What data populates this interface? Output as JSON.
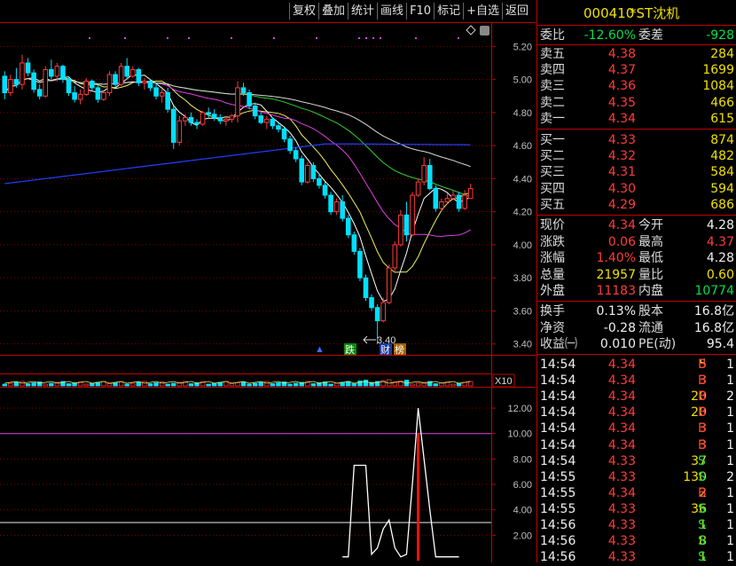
{
  "toolbar": {
    "items": [
      "复权",
      "叠加",
      "统计",
      "画线",
      "F10",
      "标记",
      "+自选",
      "返回"
    ]
  },
  "stock": {
    "code": "000410",
    "name": "*ST沈机"
  },
  "order_stats": {
    "wb_label": "委比",
    "wb_value": "-12.60%",
    "wc_label": "委差",
    "wc_value": "-928"
  },
  "asks": [
    {
      "label": "卖五",
      "price": "4.38",
      "volume": "284"
    },
    {
      "label": "卖四",
      "price": "4.37",
      "volume": "1699"
    },
    {
      "label": "卖三",
      "price": "4.36",
      "volume": "1084"
    },
    {
      "label": "卖二",
      "price": "4.35",
      "volume": "466"
    },
    {
      "label": "卖一",
      "price": "4.34",
      "volume": "615"
    }
  ],
  "bids": [
    {
      "label": "买一",
      "price": "4.33",
      "volume": "874"
    },
    {
      "label": "买二",
      "price": "4.32",
      "volume": "482"
    },
    {
      "label": "买三",
      "price": "4.31",
      "volume": "584"
    },
    {
      "label": "买四",
      "price": "4.30",
      "volume": "594"
    },
    {
      "label": "买五",
      "price": "4.29",
      "volume": "686"
    }
  ],
  "quote": [
    {
      "l1": "现价",
      "v1": "4.34",
      "c1": "red",
      "l2": "今开",
      "v2": "4.28",
      "c2": "white"
    },
    {
      "l1": "涨跌",
      "v1": "0.06",
      "c1": "red",
      "l2": "最高",
      "v2": "4.37",
      "c2": "red"
    },
    {
      "l1": "涨幅",
      "v1": "1.40%",
      "c1": "red",
      "l2": "最低",
      "v2": "4.28",
      "c2": "white"
    },
    {
      "l1": "总量",
      "v1": "21957",
      "c1": "yellow",
      "l2": "量比",
      "v2": "0.60",
      "c2": "yellow"
    },
    {
      "l1": "外盘",
      "v1": "11183",
      "c1": "red",
      "l2": "内盘",
      "v2": "10774",
      "c2": "green"
    }
  ],
  "fundamentals": [
    {
      "l1": "换手",
      "v1": "0.13%",
      "l2": "股本",
      "v2": "16.8亿"
    },
    {
      "l1": "净资",
      "v1": "-0.28",
      "l2": "流通",
      "v2": "16.8亿"
    },
    {
      "l1": "收益㈠",
      "v1": "0.010",
      "l2": "PE(动)",
      "v2": "95.4"
    }
  ],
  "ticks": [
    {
      "time": "14:54",
      "price": "4.34",
      "vol": "5",
      "side": "B",
      "n": "1"
    },
    {
      "time": "14:54",
      "price": "4.34",
      "vol": "3",
      "side": "B",
      "n": "1"
    },
    {
      "time": "14:54",
      "price": "4.34",
      "vol": "20",
      "side": "B",
      "n": "2"
    },
    {
      "time": "14:54",
      "price": "4.34",
      "vol": "20",
      "side": "B",
      "n": "1"
    },
    {
      "time": "14:54",
      "price": "4.34",
      "vol": "3",
      "side": "B",
      "n": "1"
    },
    {
      "time": "14:54",
      "price": "4.34",
      "vol": "3",
      "side": "B",
      "n": "1"
    },
    {
      "time": "14:54",
      "price": "4.33",
      "vol": "37",
      "side": "S",
      "n": "1"
    },
    {
      "time": "14:55",
      "price": "4.33",
      "vol": "130",
      "side": "S",
      "n": "2"
    },
    {
      "time": "14:55",
      "price": "4.34",
      "vol": "2",
      "side": "B",
      "n": "1"
    },
    {
      "time": "14:55",
      "price": "4.33",
      "vol": "36",
      "side": "S",
      "n": "1"
    },
    {
      "time": "14:56",
      "price": "4.33",
      "vol": "1",
      "side": "S",
      "n": "1"
    },
    {
      "time": "14:56",
      "price": "4.33",
      "vol": "8",
      "side": "S",
      "n": "1"
    },
    {
      "time": "14:56",
      "price": "4.33",
      "vol": "1",
      "side": "S",
      "n": "1"
    }
  ],
  "colors": {
    "up": "#ff3b3b",
    "down": "#00e0ff",
    "grid": "#c00000",
    "ma_long": "#2040ff"
  },
  "chart_data": [
    {
      "type": "candlestick",
      "yaxis_ticks": [
        "5.20",
        "5.00",
        "4.80",
        "4.60",
        "4.40",
        "4.20",
        "4.00",
        "3.80",
        "3.60",
        "3.40"
      ],
      "ylim": [
        3.35,
        5.32
      ],
      "low_annotation": "3.40",
      "markers": [
        "跌",
        "财",
        "榜"
      ],
      "candles": [
        [
          5.02,
          5.05,
          4.88,
          4.92
        ],
        [
          4.92,
          5.03,
          4.9,
          5.0
        ],
        [
          5.0,
          5.07,
          4.95,
          4.97
        ],
        [
          4.97,
          5.15,
          4.94,
          5.1
        ],
        [
          5.1,
          5.13,
          5.02,
          5.04
        ],
        [
          5.04,
          5.06,
          4.92,
          4.94
        ],
        [
          4.94,
          4.97,
          4.88,
          4.9
        ],
        [
          4.9,
          5.08,
          4.89,
          5.06
        ],
        [
          5.06,
          5.12,
          5.0,
          5.02
        ],
        [
          5.02,
          5.1,
          4.99,
          5.08
        ],
        [
          5.08,
          5.09,
          4.98,
          5.0
        ],
        [
          5.0,
          5.02,
          4.9,
          4.92
        ],
        [
          4.92,
          4.96,
          4.86,
          4.88
        ],
        [
          4.88,
          4.94,
          4.85,
          4.91
        ],
        [
          4.91,
          5.01,
          4.9,
          4.99
        ],
        [
          4.99,
          5.0,
          4.93,
          4.95
        ],
        [
          4.95,
          4.97,
          4.86,
          4.88
        ],
        [
          4.88,
          4.93,
          4.87,
          4.92
        ],
        [
          4.92,
          5.05,
          4.9,
          5.03
        ],
        [
          5.03,
          5.05,
          4.95,
          4.97
        ],
        [
          4.97,
          5.1,
          4.96,
          5.08
        ],
        [
          5.08,
          5.13,
          5.0,
          5.02
        ],
        [
          5.02,
          5.08,
          5.01,
          5.06
        ],
        [
          5.06,
          5.07,
          4.96,
          4.98
        ],
        [
          4.98,
          5.01,
          4.94,
          4.99
        ],
        [
          4.99,
          5.0,
          4.93,
          4.95
        ],
        [
          4.95,
          4.98,
          4.88,
          4.9
        ],
        [
          4.9,
          4.94,
          4.86,
          4.92
        ],
        [
          4.92,
          4.95,
          4.8,
          4.82
        ],
        [
          4.82,
          4.84,
          4.58,
          4.62
        ],
        [
          4.62,
          4.78,
          4.6,
          4.75
        ],
        [
          4.75,
          4.79,
          4.72,
          4.77
        ],
        [
          4.77,
          4.8,
          4.72,
          4.74
        ],
        [
          4.74,
          4.76,
          4.7,
          4.73
        ],
        [
          4.73,
          4.81,
          4.72,
          4.8
        ],
        [
          4.8,
          4.83,
          4.77,
          4.79
        ],
        [
          4.79,
          4.82,
          4.75,
          4.77
        ],
        [
          4.77,
          4.79,
          4.73,
          4.75
        ],
        [
          4.75,
          4.78,
          4.72,
          4.76
        ],
        [
          4.76,
          4.79,
          4.74,
          4.78
        ],
        [
          4.78,
          4.99,
          4.74,
          4.95
        ],
        [
          4.95,
          4.98,
          4.9,
          4.92
        ],
        [
          4.92,
          4.94,
          4.82,
          4.84
        ],
        [
          4.84,
          4.86,
          4.76,
          4.78
        ],
        [
          4.78,
          4.8,
          4.73,
          4.74
        ],
        [
          4.74,
          4.78,
          4.7,
          4.76
        ],
        [
          4.76,
          4.77,
          4.7,
          4.72
        ],
        [
          4.72,
          4.74,
          4.68,
          4.7
        ],
        [
          4.7,
          4.71,
          4.62,
          4.64
        ],
        [
          4.64,
          4.66,
          4.55,
          4.57
        ],
        [
          4.57,
          4.59,
          4.5,
          4.52
        ],
        [
          4.52,
          4.54,
          4.36,
          4.38
        ],
        [
          4.38,
          4.5,
          4.37,
          4.48
        ],
        [
          4.48,
          4.5,
          4.38,
          4.4
        ],
        [
          4.4,
          4.43,
          4.34,
          4.36
        ],
        [
          4.36,
          4.38,
          4.28,
          4.3
        ],
        [
          4.3,
          4.32,
          4.18,
          4.2
        ],
        [
          4.2,
          4.28,
          4.18,
          4.26
        ],
        [
          4.26,
          4.3,
          4.14,
          4.16
        ],
        [
          4.16,
          4.18,
          4.04,
          4.06
        ],
        [
          4.06,
          4.08,
          3.94,
          3.96
        ],
        [
          3.96,
          3.98,
          3.78,
          3.8
        ],
        [
          3.8,
          3.82,
          3.66,
          3.68
        ],
        [
          3.68,
          3.7,
          3.6,
          3.62
        ],
        [
          3.62,
          3.64,
          3.4,
          3.54
        ],
        [
          3.54,
          3.68,
          3.53,
          3.65
        ],
        [
          3.65,
          3.88,
          3.64,
          3.86
        ],
        [
          3.86,
          4.02,
          3.84,
          4.0
        ],
        [
          4.0,
          4.21,
          3.99,
          4.18
        ],
        [
          4.18,
          4.26,
          4.02,
          4.06
        ],
        [
          4.06,
          4.32,
          4.05,
          4.3
        ],
        [
          4.3,
          4.4,
          4.29,
          4.38
        ],
        [
          4.38,
          4.53,
          4.36,
          4.48
        ],
        [
          4.48,
          4.52,
          4.33,
          4.34
        ],
        [
          4.34,
          4.36,
          4.2,
          4.22
        ],
        [
          4.22,
          4.28,
          4.2,
          4.26
        ],
        [
          4.26,
          4.31,
          4.25,
          4.28
        ],
        [
          4.28,
          4.33,
          4.27,
          4.3
        ],
        [
          4.3,
          4.32,
          4.2,
          4.22
        ],
        [
          4.22,
          4.33,
          4.21,
          4.3
        ],
        [
          4.28,
          4.37,
          4.28,
          4.34
        ]
      ]
    },
    {
      "type": "line",
      "xlabel_box": "X10",
      "yaxis_ticks": [
        "12.00",
        "10.00",
        "8.00",
        "6.00",
        "4.00",
        "2.00"
      ],
      "ylim": [
        0,
        13.4
      ],
      "reference_lines": [
        10.0,
        3.0
      ],
      "values": [
        0.3,
        0.3,
        7.5,
        7.5,
        7.5,
        0.5,
        1.0,
        2.5,
        3.2,
        1.0,
        0.3,
        0.5,
        6.0,
        12.0,
        8.0,
        4.0,
        0.3,
        0.3,
        0.3,
        0.3,
        0.3
      ],
      "signal_bar_value": 10.0
    }
  ]
}
